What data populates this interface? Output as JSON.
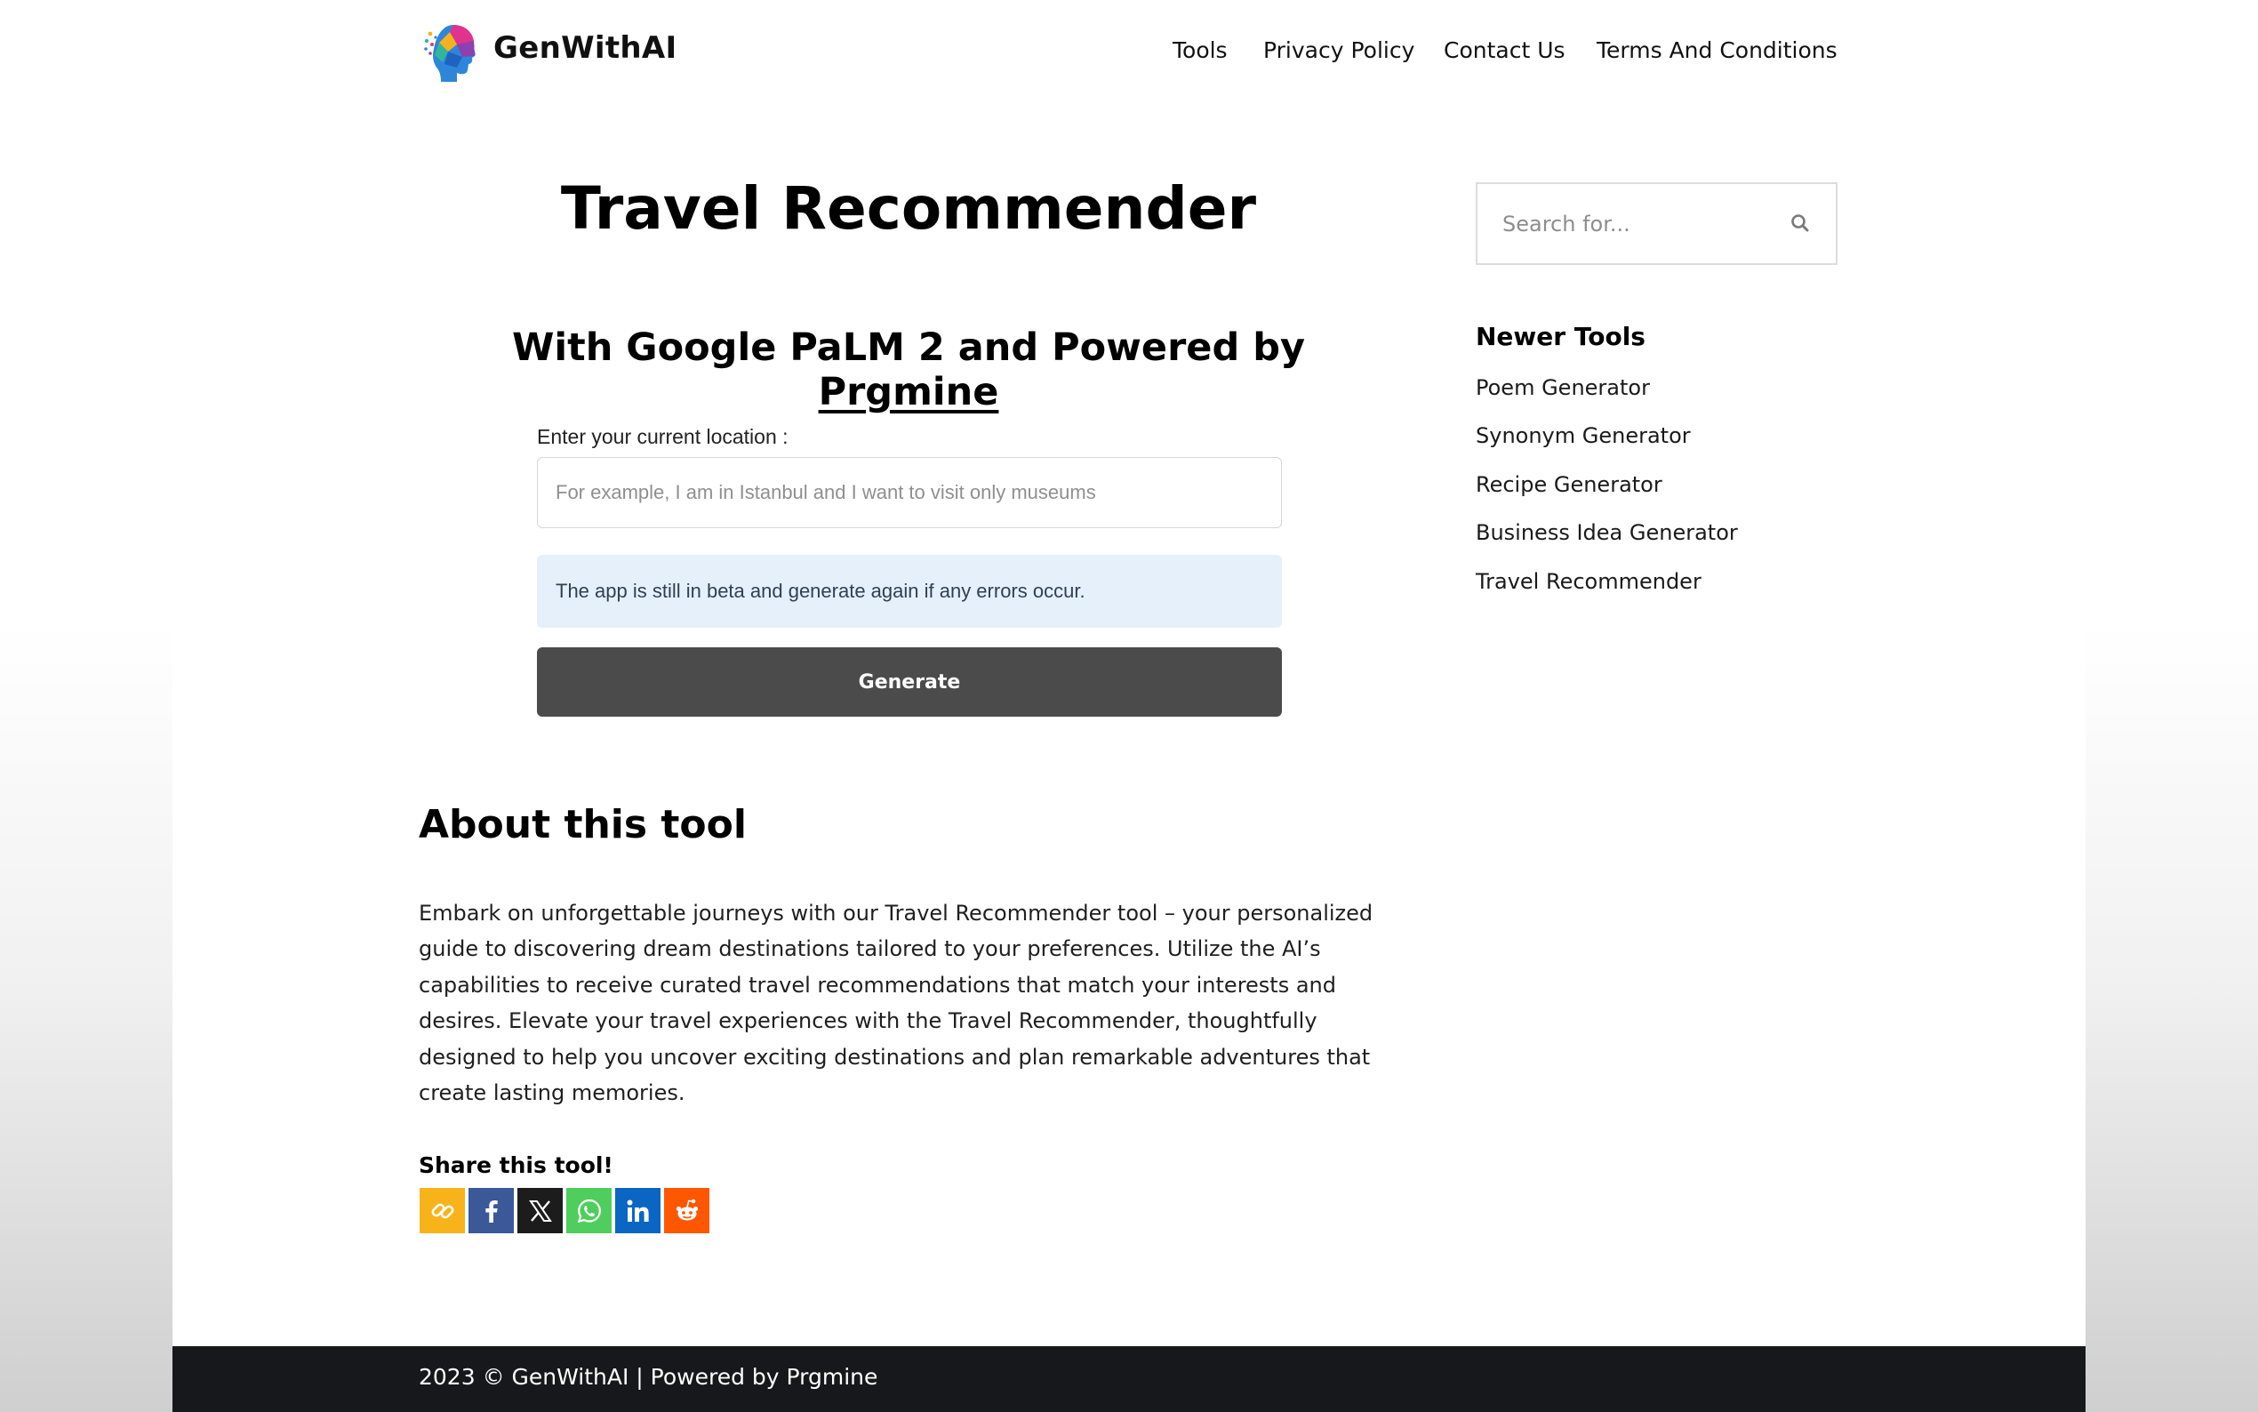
{
  "header": {
    "brand": "GenWithAI",
    "nav": [
      "Tools",
      "Privacy Policy",
      "Contact Us",
      "Terms And Conditions"
    ]
  },
  "main": {
    "title": "Travel Recommender",
    "subtitle_prefix": "With Google PaLM 2 and Powered by ",
    "subtitle_link": "Prgmine",
    "form": {
      "label": "Enter your current location :",
      "placeholder": "For example, I am in Istanbul and I want to visit only museums",
      "value": ""
    },
    "beta_note": "The app is still in beta and generate again if any errors occur.",
    "generate_label": "Generate",
    "about": {
      "heading": "About this tool",
      "body": "Embark on unforgettable journeys with our Travel Recommender tool – your personalized guide to discovering dream destinations tailored to your preferences. Utilize the AI’s capabilities to receive curated travel recommendations that match your interests and desires. Elevate your travel experiences with the Travel Recommender, thoughtfully designed to help you uncover exciting destinations and plan remarkable adventures that create lasting memories."
    },
    "share": {
      "heading": "Share this tool!",
      "buttons": [
        {
          "icon": "link-icon",
          "color": "#f8b31b"
        },
        {
          "icon": "facebook-icon",
          "color": "#3b5998"
        },
        {
          "icon": "x-icon",
          "color": "#1c1c1c"
        },
        {
          "icon": "whatsapp-icon",
          "color": "#4fce5d"
        },
        {
          "icon": "linkedin-icon",
          "color": "#0a66c2"
        },
        {
          "icon": "reddit-icon",
          "color": "#ff5700"
        }
      ]
    }
  },
  "sidebar": {
    "search_placeholder": "Search for...",
    "heading": "Newer Tools",
    "items": [
      "Poem Generator",
      "Synonym Generator",
      "Recipe Generator",
      "Business Idea Generator",
      "Travel Recommender"
    ]
  },
  "footer": {
    "text": "2023 © GenWithAI | Powered by Prgmine"
  }
}
